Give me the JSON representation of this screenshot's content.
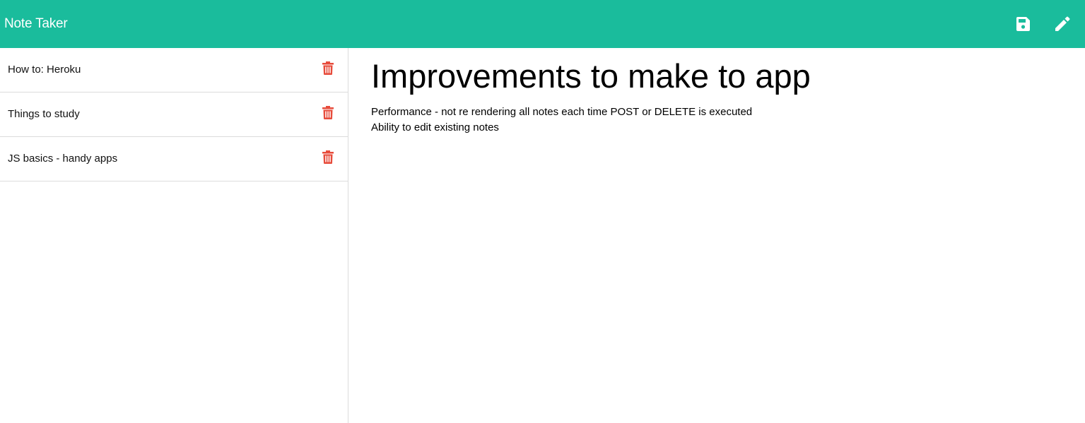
{
  "app": {
    "title": "Note Taker"
  },
  "toolbar": {
    "save_icon": "save-icon",
    "edit_icon": "pencil-icon"
  },
  "notes": [
    {
      "title": "How to: Heroku"
    },
    {
      "title": "Things to study"
    },
    {
      "title": "JS basics - handy apps"
    }
  ],
  "active_note": {
    "title": "Improvements to make to app",
    "lines": [
      "Performance - not re rendering all notes each time POST or DELETE is executed",
      "Ability to edit existing notes"
    ]
  },
  "colors": {
    "accent": "#1abc9c",
    "delete": "#e74c3c",
    "divider": "#dcdcdc"
  }
}
